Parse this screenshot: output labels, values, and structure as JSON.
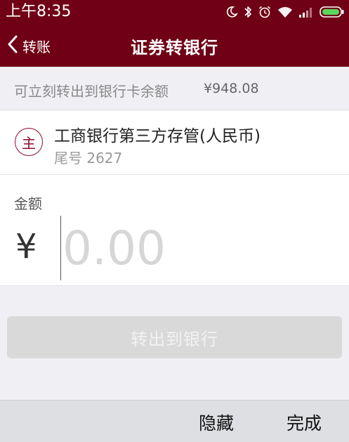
{
  "status_bar": {
    "time": "上午8:35",
    "icons": [
      "moon-icon",
      "bluetooth-icon",
      "alarm-icon",
      "wifi-icon",
      "signal-icon",
      "battery-icon"
    ]
  },
  "nav": {
    "back_label": "转账",
    "title": "证券转银行"
  },
  "balance": {
    "label": "可立刻转出到银行卡余额",
    "value": "¥948.08"
  },
  "bank": {
    "logo_char": "主",
    "name": "工商银行第三方存管(人民币)",
    "tail": "尾号 2627"
  },
  "amount": {
    "label": "金额",
    "currency_symbol": "¥",
    "value": "",
    "placeholder": "0.00"
  },
  "submit": {
    "label": "转出到银行",
    "enabled": false
  },
  "keyboard_toolbar": {
    "hide_label": "隐藏",
    "done_label": "完成"
  },
  "colors": {
    "header_bg": "#6f0016",
    "accent": "#8c0a2a",
    "button_disabled": "#d9d9d9"
  }
}
